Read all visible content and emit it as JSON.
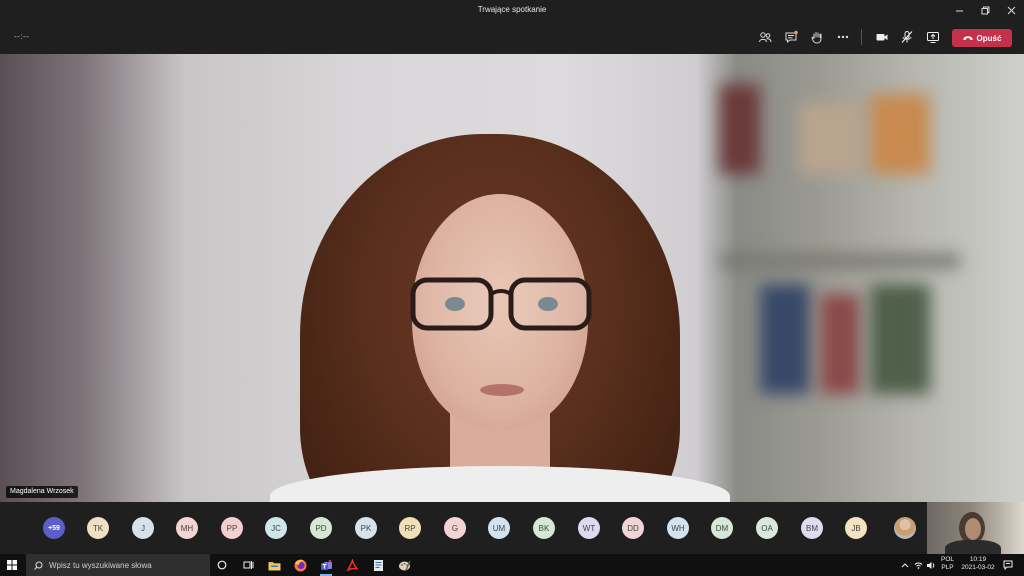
{
  "window": {
    "title": "Trwające spotkanie"
  },
  "toolbar": {
    "timer": "--:--",
    "leave_label": "Opuść"
  },
  "stage": {
    "speaker_name": "Magdalena Wrzosek"
  },
  "participants": {
    "overflow_label": "+59",
    "initials": [
      "TK",
      "J",
      "MH",
      "PP",
      "JC",
      "PD",
      "PK",
      "RP",
      "G",
      "UM",
      "BK",
      "WT",
      "DD",
      "WH",
      "DM",
      "OA",
      "BM",
      "JB"
    ],
    "colors": [
      "#f2dfc3",
      "#d9e1ea",
      "#f3d3d3",
      "#f3d0cd",
      "#cfe6e8",
      "#d5e8d6",
      "#d7e3ec",
      "#f0e0b8",
      "#f1d4d3",
      "#d3e2ef",
      "#d4e8d8",
      "#dcd9f0",
      "#f3d4d6",
      "#d3e2ef",
      "#d4e8d8",
      "#d8e8dc",
      "#e0dcf0",
      "#f4e2c0"
    ]
  },
  "taskbar": {
    "search_placeholder": "Wpisz tu wyszukiwane słowa",
    "lang_top": "POL",
    "lang_bottom": "PLP",
    "time": "10:19",
    "date": "2021-03-02"
  }
}
